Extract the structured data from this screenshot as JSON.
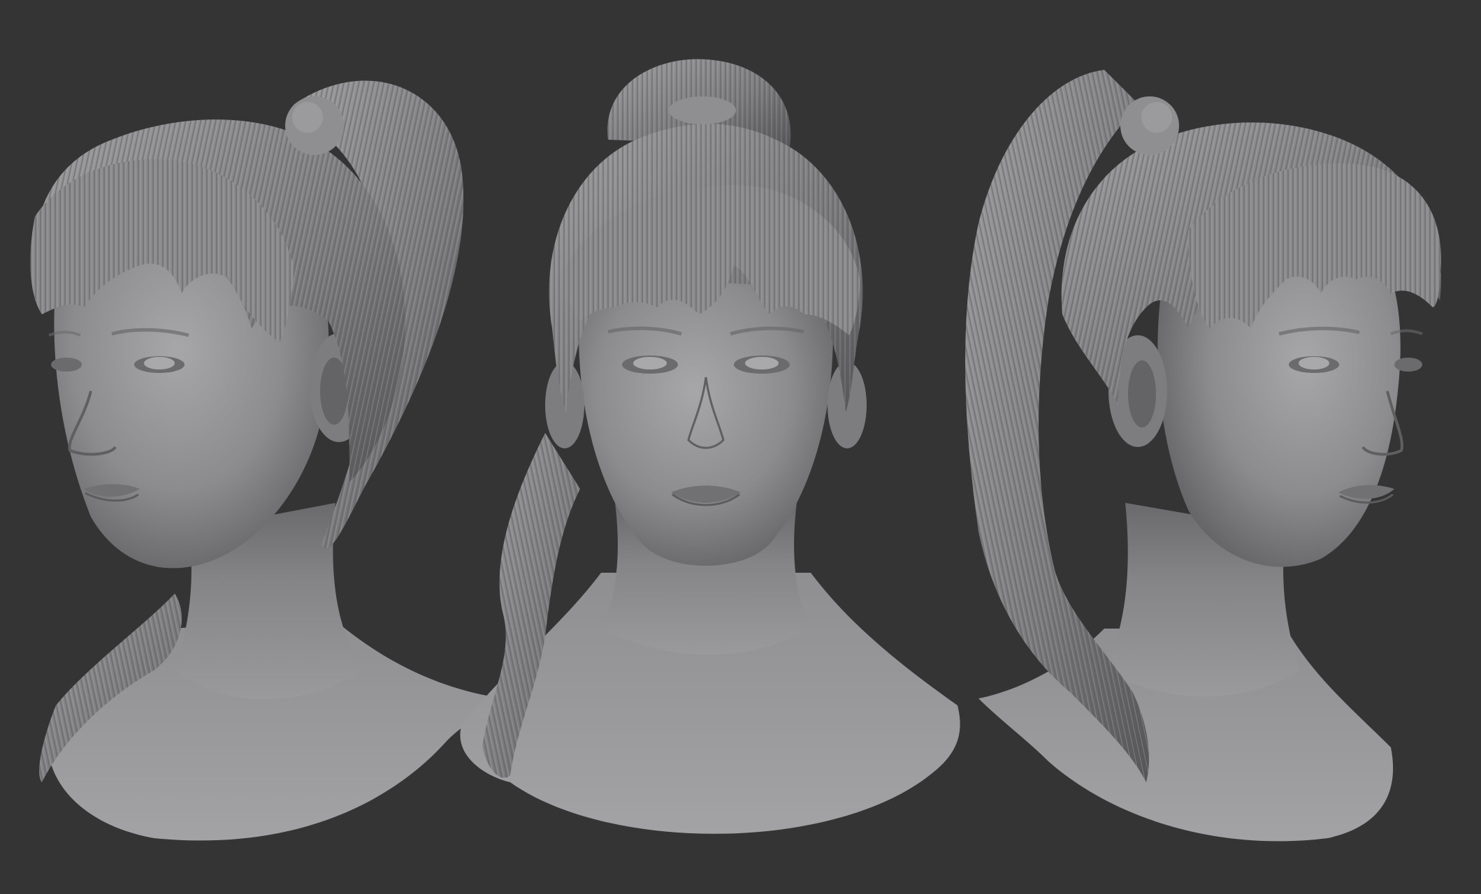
{
  "scene": {
    "background_color": "#343435",
    "sculpt_color": "#8e8e90",
    "sculpt_shadow": "#4a4a4c",
    "sculpt_highlight": "#b9b9bb",
    "views": [
      {
        "name": "three-quarter-left",
        "subject": "female-head-bust-ponytail"
      },
      {
        "name": "front",
        "subject": "female-head-bust-ponytail"
      },
      {
        "name": "three-quarter-right",
        "subject": "female-head-bust-ponytail"
      }
    ]
  }
}
